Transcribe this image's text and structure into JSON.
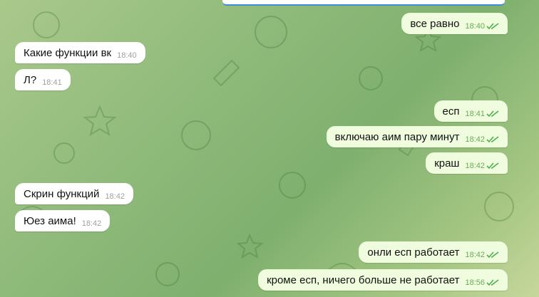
{
  "messages": [
    {
      "side": "out",
      "text": "все равно",
      "time": "18:40"
    },
    {
      "side": "in",
      "text": "Какие функции вк",
      "time": "18:40"
    },
    {
      "side": "in",
      "text": "Л?",
      "time": "18:41"
    },
    {
      "side": "out",
      "text": "есп",
      "time": "18:41"
    },
    {
      "side": "out",
      "text": "включаю аим пару минут",
      "time": "18:42"
    },
    {
      "side": "out",
      "text": "краш",
      "time": "18:42"
    },
    {
      "side": "in",
      "text": "Скрин функций",
      "time": "18:42"
    },
    {
      "side": "in",
      "text": "Юез аима!",
      "time": "18:42"
    },
    {
      "side": "out",
      "text": "онли есп работает",
      "time": "18:42"
    },
    {
      "side": "out",
      "text": "кроме есп, ничего больше не работает",
      "time": "18:56"
    }
  ],
  "icons": {
    "read_receipt": "double-check-icon"
  },
  "colors": {
    "incoming_bubble": "#ffffff",
    "outgoing_bubble": "#effdde",
    "read_check": "#4fae4e"
  }
}
